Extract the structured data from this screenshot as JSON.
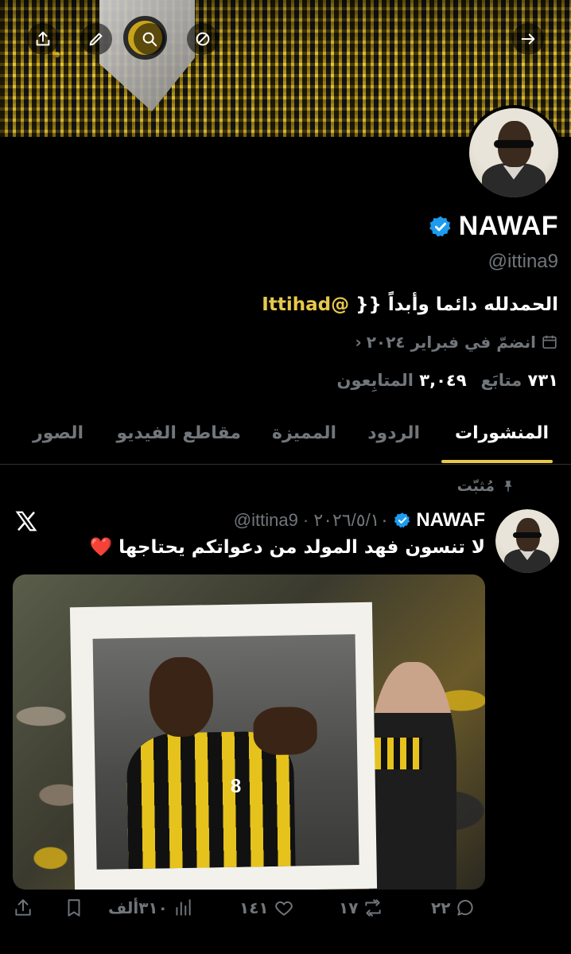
{
  "header": {
    "share_icon": "share-icon",
    "edit_icon": "pencil-icon",
    "search_icon": "search-icon",
    "block_icon": "slash-circle-icon",
    "forward_icon": "arrow-right-icon"
  },
  "profile": {
    "display_name": "NAWAF",
    "handle": "@ittina9",
    "bio_text": "الحمدلله دائما وأبداً {{",
    "bio_mention": "@Ittihad",
    "joined": "انضمّ في فبراير ٢٠٢٤",
    "following_count": "٧٣١",
    "following_label": "متابَع",
    "followers_count": "٣,٠٤٩",
    "followers_label": "المتابِعون",
    "verified_color": "#1d9bf0"
  },
  "tabs": [
    {
      "label": "المنشورات",
      "active": true
    },
    {
      "label": "الردود"
    },
    {
      "label": "المميزة"
    },
    {
      "label": "مقاطع الفيديو"
    },
    {
      "label": "الصور"
    }
  ],
  "accent_color": "#e8c84a",
  "pinned_post": {
    "pinned_label": "مُثبّت",
    "author": "NAWAF",
    "handle_date": "@ittina9 · ٢٠٢٦/٥/١٠",
    "text": "لا تنسون فهد المولد من دعواتكم يحتاجها",
    "emoji": "❤️",
    "actions": {
      "replies": "٢٢",
      "reposts": "١٧",
      "likes": "١٤١",
      "views": "٣١٠ألف"
    }
  }
}
